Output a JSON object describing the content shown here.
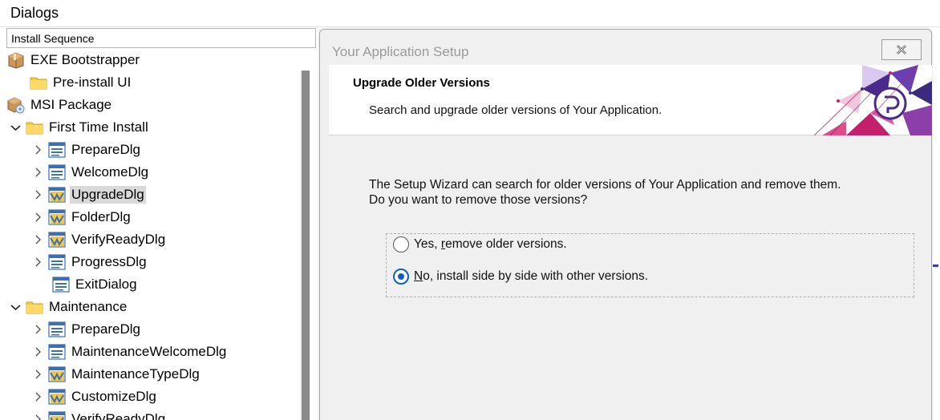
{
  "header": {
    "title": "Dialogs"
  },
  "sequence": {
    "value": "Install Sequence"
  },
  "tree": {
    "items": [
      {
        "label": "EXE Bootstrapper",
        "icon": "package-icon",
        "indent": 0,
        "chevron": "none"
      },
      {
        "label": "Pre-install UI",
        "icon": "folder-icon",
        "indent": 1,
        "chevron": "none"
      },
      {
        "label": "MSI Package",
        "icon": "msi-package-icon",
        "indent": 0,
        "chevron": "none"
      },
      {
        "label": "First Time Install",
        "icon": "folder-icon",
        "indent": 0,
        "chevron": "down"
      },
      {
        "label": "PrepareDlg",
        "icon": "dialog-icon",
        "indent": 1,
        "chevron": "right"
      },
      {
        "label": "WelcomeDlg",
        "icon": "dialog-icon",
        "indent": 1,
        "chevron": "right"
      },
      {
        "label": "UpgradeDlg",
        "icon": "custom-dialog-icon",
        "indent": 1,
        "chevron": "right",
        "selected": true
      },
      {
        "label": "FolderDlg",
        "icon": "custom-dialog-icon",
        "indent": 1,
        "chevron": "right"
      },
      {
        "label": "VerifyReadyDlg",
        "icon": "custom-dialog-icon",
        "indent": 1,
        "chevron": "right"
      },
      {
        "label": "ProgressDlg",
        "icon": "dialog-icon",
        "indent": 1,
        "chevron": "right"
      },
      {
        "label": "ExitDialog",
        "icon": "dialog-icon",
        "indent": 1,
        "chevron": "none"
      },
      {
        "label": "Maintenance",
        "icon": "folder-icon",
        "indent": 0,
        "chevron": "down"
      },
      {
        "label": "PrepareDlg",
        "icon": "dialog-icon",
        "indent": 1,
        "chevron": "right"
      },
      {
        "label": "MaintenanceWelcomeDlg",
        "icon": "dialog-icon",
        "indent": 1,
        "chevron": "right"
      },
      {
        "label": "MaintenanceTypeDlg",
        "icon": "custom-dialog-icon",
        "indent": 1,
        "chevron": "right"
      },
      {
        "label": "CustomizeDlg",
        "icon": "custom-dialog-icon",
        "indent": 1,
        "chevron": "right"
      },
      {
        "label": "VerifyReadyDlg",
        "icon": "custom-dialog-icon",
        "indent": 1,
        "chevron": "right"
      }
    ]
  },
  "dialog": {
    "title": "Your Application Setup",
    "close_icon": "close-icon",
    "banner_title": "Upgrade Older Versions",
    "banner_subtitle": "Search and upgrade older versions of Your Application.",
    "description_line1": "The Setup Wizard can search for older versions of Your Application and remove them.",
    "description_line2": "Do you want to remove those versions?",
    "options": [
      {
        "pre": "Yes, ",
        "access": "r",
        "post": "emove older versions.",
        "checked": false
      },
      {
        "pre": "",
        "access": "N",
        "post": "o, install side by side with other versions.",
        "checked": true
      }
    ]
  },
  "colors": {
    "accent": "#0b5ec4",
    "banner_magenta": "#c4206d",
    "banner_purple": "#4a2a8c",
    "folder": "#f5c842",
    "dialog_icon_blue": "#3a6fb7"
  }
}
